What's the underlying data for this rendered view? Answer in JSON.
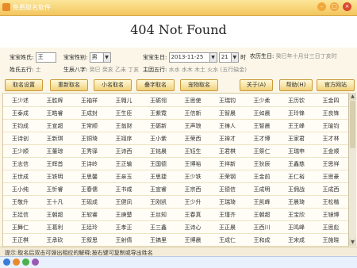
{
  "window": {
    "title": "免费取名软件"
  },
  "header": {
    "heading": "404 Not Found"
  },
  "form": {
    "surname_label": "宝宝姓氏:",
    "surname_value": "王",
    "gender_label": "宝宝性别:",
    "gender_value": "男",
    "birthday_label": "宝宝生日:",
    "birthday_value": "2013-11-25",
    "hour_value": "21",
    "hour_unit": "时",
    "lunar_label": "农历生日:",
    "lunar_value": "癸巳年十月廿三日丁亥时",
    "wuxing_label": "姓氏五行:",
    "wuxing_value": "土",
    "bazi_label": "生辰八字:",
    "bazi_value": "癸巳 癸亥 乙未 丁亥",
    "main_wuxing_label": "主因五行:",
    "main_wuxing_value": "水水 水木 木土 火水 (五行缺金)"
  },
  "toolbar": {
    "buttons": [
      "取名设置",
      "重新取名",
      "小名取名",
      "叠字取名",
      "宠物取名",
      "关于(A)",
      "帮助(H)",
      "官方网站"
    ]
  },
  "names": [
    [
      "王少述",
      "王胜辉",
      "王袖祥",
      "王翱儿",
      "王砺翎",
      "王思使",
      "王瑞钧",
      "王少柔",
      "王历钦",
      "王金四"
    ],
    [
      "王泰成",
      "王皓睿",
      "王成封",
      "王生臣",
      "王紫霓",
      "王信新",
      "王智晨",
      "王如晨",
      "王玲锋",
      "王良锋"
    ],
    [
      "王钧成",
      "王宣超",
      "王常顺",
      "王翁财",
      "王砺新",
      "王声琅",
      "王祷人",
      "王智晨",
      "王王峰",
      "王瑜钧"
    ],
    [
      "王诗创",
      "王新琪",
      "王铜琦",
      "王翊序",
      "王小紫",
      "王荣西",
      "王禅才",
      "王才博",
      "王家君",
      "王才林"
    ],
    [
      "王少顺",
      "王董琼",
      "王秀驿",
      "王诗西",
      "王铭晨",
      "王钰生",
      "王君棋",
      "王祭仁",
      "王瑞申",
      "王金顺"
    ],
    [
      "王志信",
      "王辉首",
      "王诗岭",
      "王正输",
      "王国德",
      "王博裕",
      "王祥新",
      "王狄辰",
      "王鑫慈",
      "王思祥"
    ],
    [
      "王世成",
      "王铁明",
      "王思馨",
      "王亲玉",
      "王思捷",
      "王少铁",
      "王荣钢",
      "王金前",
      "王仁裕",
      "王思豪"
    ],
    [
      "王小纯",
      "王忻睿",
      "王春儒",
      "王书咸",
      "王宣睿",
      "王宗西",
      "王德信",
      "王成明",
      "王佣战",
      "王成西"
    ],
    [
      "王敬升",
      "王十凡",
      "王砚成",
      "王健凤",
      "王刚凯",
      "王少升",
      "王瑞琦",
      "王凯峰",
      "王晨琦",
      "王松楷"
    ],
    [
      "王廷信",
      "王朝超",
      "王软睿",
      "王庚楚",
      "王丝知",
      "王春真",
      "王瑾齐",
      "王朝超",
      "王宝欣",
      "王镜博"
    ],
    [
      "王舞仁",
      "王葛利",
      "王廷玲",
      "王孝正",
      "王三鑫",
      "王诗心",
      "王正晨",
      "王西川",
      "王鸣峰",
      "王思彪"
    ],
    [
      "王正棋",
      "王承砍",
      "王叙思",
      "王射倩",
      "王镐里",
      "王博晨",
      "王成仁",
      "王和成",
      "王宋成",
      "王施晓"
    ]
  ],
  "status": {
    "tip": "提示:取名后双击可弹出相应的解释;按右键可复制或导出姓名"
  },
  "colors": {
    "titlebar": "#f3c65e",
    "accent": "#e98a2a",
    "close": "#d9482f"
  }
}
